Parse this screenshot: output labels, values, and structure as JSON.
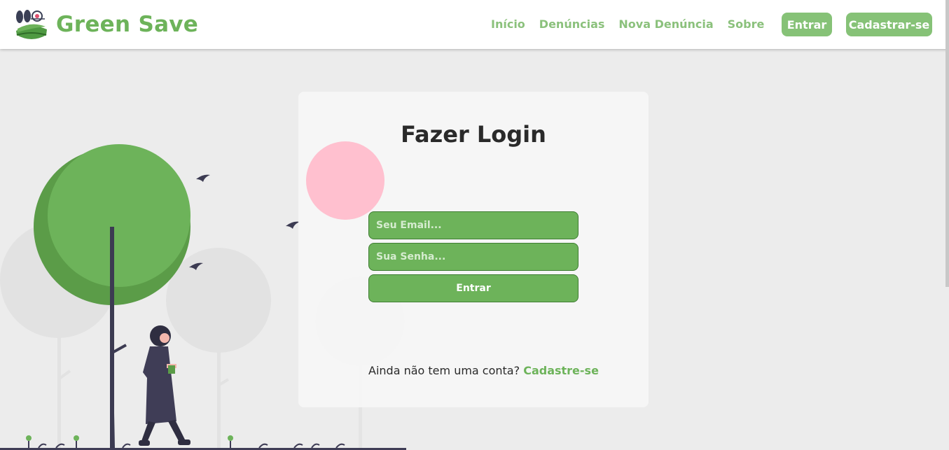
{
  "header": {
    "brand": "Green Save",
    "nav": [
      "Início",
      "Denúncias",
      "Nova Denúncia",
      "Sobre"
    ],
    "login_button": "Entrar",
    "signup_button": "Cadastrar-se"
  },
  "login": {
    "title": "Fazer Login",
    "email_placeholder": "Seu Email...",
    "password_placeholder": "Sua Senha...",
    "submit_label": "Entrar",
    "signup_prompt": "Ainda não tem uma conta?",
    "signup_link": "Cadastre-se"
  },
  "colors": {
    "brand_green": "#6db35a",
    "nav_green": "#8bc17c",
    "pink_circle": "#ffc0cf",
    "page_background": "#ececec"
  },
  "icons": [
    "logo-icon"
  ]
}
